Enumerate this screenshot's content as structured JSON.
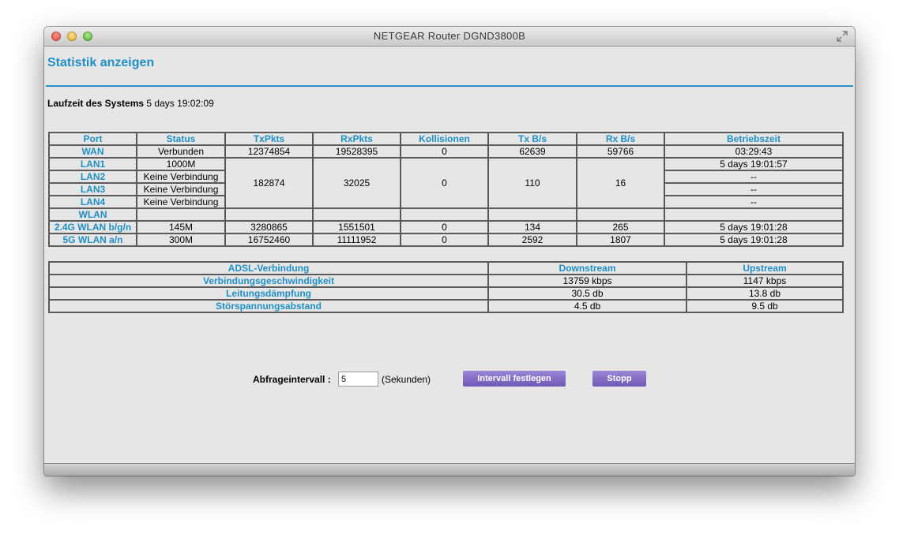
{
  "window": {
    "title": "NETGEAR Router DGND3800B"
  },
  "page": {
    "title": "Statistik anzeigen",
    "uptime_label": "Laufzeit des Systems",
    "uptime_value": "5 days 19:02:09"
  },
  "stats": {
    "headers": [
      "Port",
      "Status",
      "TxPkts",
      "RxPkts",
      "Kollisionen",
      "Tx B/s",
      "Rx B/s",
      "Betriebszeit"
    ],
    "wan": {
      "port": "WAN",
      "status": "Verbunden",
      "txpkts": "12374854",
      "rxpkts": "19528395",
      "collisions": "0",
      "txbs": "62639",
      "rxbs": "59766",
      "uptime": "03:29:43"
    },
    "lan_shared": {
      "txpkts": "182874",
      "rxpkts": "32025",
      "collisions": "0",
      "txbs": "110",
      "rxbs": "16"
    },
    "lan": [
      {
        "port": "LAN1",
        "status": "1000M",
        "uptime": "5 days 19:01:57"
      },
      {
        "port": "LAN2",
        "status": "Keine Verbindung",
        "uptime": "--"
      },
      {
        "port": "LAN3",
        "status": "Keine Verbindung",
        "uptime": "--"
      },
      {
        "port": "LAN4",
        "status": "Keine Verbindung",
        "uptime": "--"
      }
    ],
    "wlan_label": "WLAN",
    "wlan": [
      {
        "port": "2.4G WLAN b/g/n",
        "status": "145M",
        "txpkts": "3280865",
        "rxpkts": "1551501",
        "collisions": "0",
        "txbs": "134",
        "rxbs": "265",
        "uptime": "5 days 19:01:28"
      },
      {
        "port": "5G WLAN a/n",
        "status": "300M",
        "txpkts": "16752460",
        "rxpkts": "11111952",
        "collisions": "0",
        "txbs": "2592",
        "rxbs": "1807",
        "uptime": "5 days 19:01:28"
      }
    ]
  },
  "adsl": {
    "headers": [
      "ADSL-Verbindung",
      "Downstream",
      "Upstream"
    ],
    "rows": [
      {
        "label": "Verbindungsgeschwindigkeit",
        "down": "13759 kbps",
        "up": "1147 kbps"
      },
      {
        "label": "Leitungsdämpfung",
        "down": "30.5 db",
        "up": "13.8 db"
      },
      {
        "label": "Störspannungsabstand",
        "down": "4.5 db",
        "up": "9.5 db"
      }
    ]
  },
  "interval": {
    "label": "Abfrageintervall :",
    "value": "5",
    "unit": "(Sekunden)",
    "set_button": "Intervall festlegen",
    "stop_button": "Stopp"
  },
  "colors": {
    "accent": "#1f8fc6",
    "button": "#7b64c2",
    "background": "#e6e6e6"
  },
  "icons": {
    "fullscreen": "fullscreen-icon"
  }
}
